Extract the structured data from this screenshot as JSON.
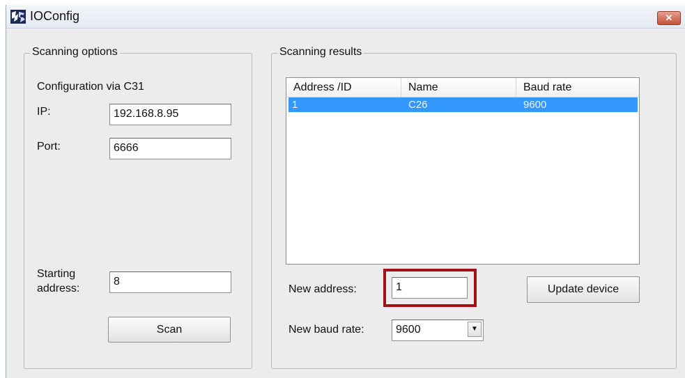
{
  "window": {
    "title": "IOConfig",
    "close_label": "✕"
  },
  "scanning_options": {
    "group_label": "Scanning options",
    "config_label": "Configuration via C31",
    "ip_label": "IP:",
    "ip_value": "192.168.8.95",
    "port_label": "Port:",
    "port_value": "6666",
    "starting_label_line1": "Starting",
    "starting_label_line2": "address:",
    "starting_value": "8",
    "scan_button": "Scan"
  },
  "scanning_results": {
    "group_label": "Scanning results",
    "columns": [
      "Address /ID",
      "Name",
      "Baud rate"
    ],
    "rows": [
      {
        "address": "1",
        "name": "C26",
        "baud": "9600",
        "selected": true
      }
    ],
    "new_address_label": "New address:",
    "new_address_value": "1",
    "update_button": "Update device",
    "new_baud_label": "New baud rate:",
    "new_baud_value": "9600",
    "combo_arrow": "▼"
  },
  "colors": {
    "selection": "#3399ff",
    "highlight_border": "#a0111a",
    "close_button": "#c4523a"
  }
}
